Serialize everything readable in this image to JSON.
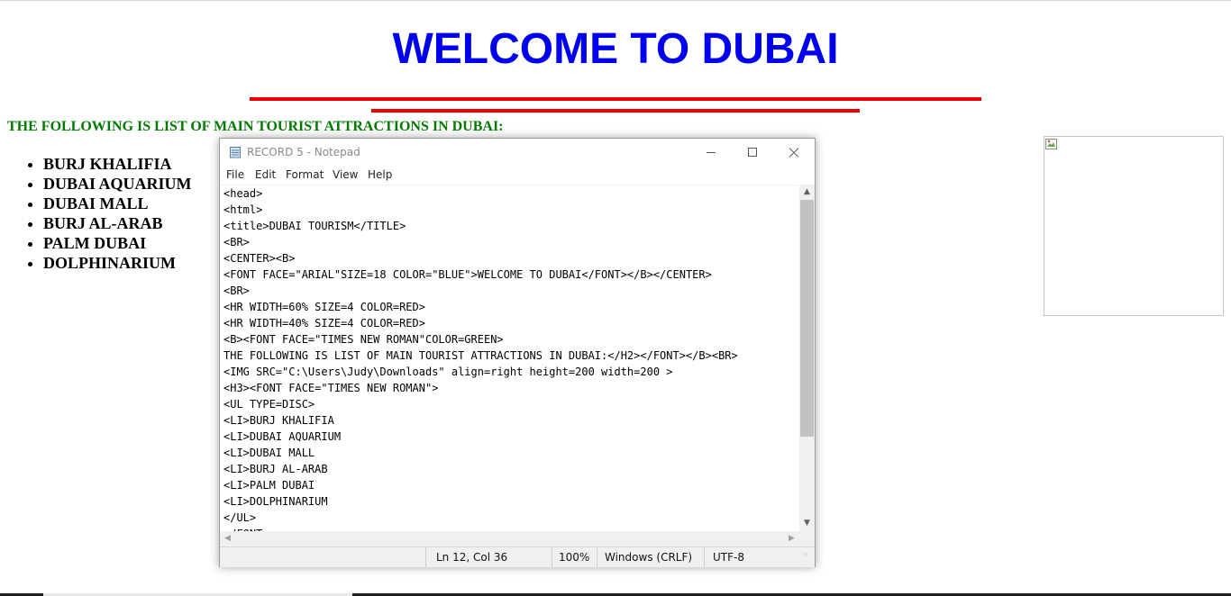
{
  "page": {
    "title": "WELCOME TO DUBAI",
    "subtitle": "THE FOLLOWING IS LIST OF MAIN TOURIST ATTRACTIONS IN DUBAI:",
    "attractions": [
      "BURJ KHALIFIA",
      "DUBAI AQUARIUM",
      "DUBAI MALL",
      "BURJ AL-ARAB",
      "PALM DUBAI",
      "DOLPHINARIUM"
    ],
    "colors": {
      "title": "#0000ee",
      "rule": "#ee0000",
      "subtitle": "#007a00"
    },
    "image_icon": "broken-image-icon"
  },
  "notepad": {
    "window_title": "RECORD 5 - Notepad",
    "menu": [
      "File",
      "Edit",
      "Format",
      "View",
      "Help"
    ],
    "lines": [
      "<head>",
      "<html>",
      "<title>DUBAI TOURISM</TITLE>",
      "<BR>",
      "<CENTER><B>",
      "<FONT FACE=\"ARIAL\"SIZE=18 COLOR=\"BLUE\">WELCOME TO DUBAI</FONT></B></CENTER>",
      "<BR>",
      "<HR WIDTH=60% SIZE=4 COLOR=RED>",
      "<HR WIDTH=40% SIZE=4 COLOR=RED>",
      "<B><FONT FACE=\"TIMES NEW ROMAN\"COLOR=GREEN>",
      "THE FOLLOWING IS LIST OF MAIN TOURIST ATTRACTIONS IN DUBAI:</H2></FONT></B><BR>",
      "<IMG SRC=\"C:\\Users\\Judy\\Downloads\" align=right height=200 width=200 >",
      "<H3><FONT FACE=\"TIMES NEW ROMAN\">",
      "<UL TYPE=DISC>",
      "<LI>BURJ KHALIFIA",
      "<LI>DUBAI AQUARIUM",
      "<LI>DUBAI MALL",
      "<LI>BURJ AL-ARAB",
      "<LI>PALM DUBAI",
      "<LI>DOLPHINARIUM",
      "</UL>",
      "</FONT"
    ],
    "status": {
      "position": "Ln 12, Col 36",
      "zoom": "100%",
      "line_endings": "Windows (CRLF)",
      "encoding": "UTF-8"
    },
    "icons": {
      "app": "notepad-icon",
      "minimize": "minimize-icon",
      "maximize": "maximize-icon",
      "close": "close-icon"
    }
  }
}
